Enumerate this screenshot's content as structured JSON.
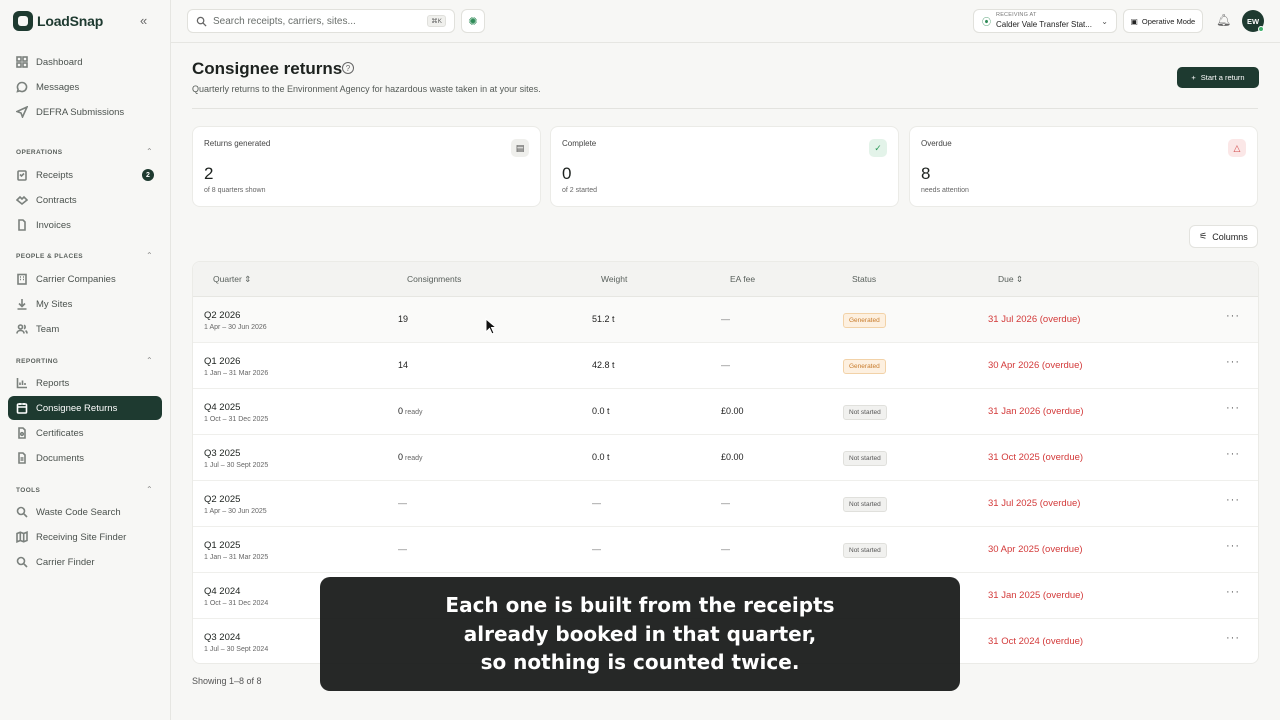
{
  "app": {
    "name": "LoadSnap"
  },
  "sidebar": {
    "top_items": [
      {
        "label": "Dashboard",
        "icon": "grid-icon"
      },
      {
        "label": "Messages",
        "icon": "message-icon"
      },
      {
        "label": "DEFRA Submissions",
        "icon": "send-icon"
      }
    ],
    "sections": [
      {
        "title": "OPERATIONS",
        "items": [
          {
            "label": "Receipts",
            "icon": "clipboard-icon",
            "badge": "2"
          },
          {
            "label": "Contracts",
            "icon": "handshake-icon"
          },
          {
            "label": "Invoices",
            "icon": "file-icon"
          }
        ]
      },
      {
        "title": "PEOPLE & PLACES",
        "items": [
          {
            "label": "Carrier Companies",
            "icon": "building-icon"
          },
          {
            "label": "My Sites",
            "icon": "download-icon"
          },
          {
            "label": "Team",
            "icon": "users-icon"
          }
        ]
      },
      {
        "title": "REPORTING",
        "items": [
          {
            "label": "Reports",
            "icon": "bar-chart-icon"
          },
          {
            "label": "Consignee Returns",
            "icon": "calendar-icon",
            "active": true
          },
          {
            "label": "Certificates",
            "icon": "certificate-icon"
          },
          {
            "label": "Documents",
            "icon": "document-icon"
          }
        ]
      },
      {
        "title": "TOOLS",
        "items": [
          {
            "label": "Waste Code Search",
            "icon": "search-icon"
          },
          {
            "label": "Receiving Site Finder",
            "icon": "map-icon"
          },
          {
            "label": "Carrier Finder",
            "icon": "search-icon"
          }
        ]
      }
    ]
  },
  "topbar": {
    "search_placeholder": "Search receipts, carriers, sites...",
    "search_shortcut": "⌘K",
    "site_label": "RECEIVING AT",
    "site_value": "Calder Vale Transfer Stat...",
    "mode_label": "Operative Mode",
    "avatar_initials": "EW"
  },
  "page": {
    "title": "Consignee returns",
    "subtitle": "Quarterly returns to the Environment Agency for hazardous waste taken in at your sites.",
    "primary_button": "Start a return",
    "columns_button": "Columns",
    "showing": "Showing 1–8 of 8"
  },
  "stats": [
    {
      "label": "Returns generated",
      "value": "2",
      "sub": "of 8 quarters shown",
      "icon": "document-icon"
    },
    {
      "label": "Complete",
      "value": "0",
      "sub": "of 2 started",
      "icon": "check-circle-icon"
    },
    {
      "label": "Overdue",
      "value": "8",
      "sub": "needs attention",
      "icon": "warning-icon"
    }
  ],
  "table": {
    "headers": [
      "Quarter",
      "Consignments",
      "Weight",
      "EA fee",
      "Status",
      "Due"
    ],
    "rows": [
      {
        "quarter": "Q2 2026",
        "range": "1 Apr – 30 Jun 2026",
        "consignments": "19",
        "ready": "",
        "weight": "51.2 t",
        "fee": "—",
        "status": "Generated",
        "due": "31 Jul 2026 (overdue)"
      },
      {
        "quarter": "Q1 2026",
        "range": "1 Jan – 31 Mar 2026",
        "consignments": "14",
        "ready": "",
        "weight": "42.8 t",
        "fee": "—",
        "status": "Generated",
        "due": "30 Apr 2026 (overdue)"
      },
      {
        "quarter": "Q4 2025",
        "range": "1 Oct – 31 Dec 2025",
        "consignments": "0",
        "ready": "ready",
        "weight": "0.0 t",
        "fee": "£0.00",
        "status": "Not started",
        "due": "31 Jan 2026 (overdue)"
      },
      {
        "quarter": "Q3 2025",
        "range": "1 Jul – 30 Sept 2025",
        "consignments": "0",
        "ready": "ready",
        "weight": "0.0 t",
        "fee": "£0.00",
        "status": "Not started",
        "due": "31 Oct 2025 (overdue)"
      },
      {
        "quarter": "Q2 2025",
        "range": "1 Apr – 30 Jun 2025",
        "consignments": "—",
        "ready": "",
        "weight": "—",
        "fee": "—",
        "status": "Not started",
        "due": "31 Jul 2025 (overdue)"
      },
      {
        "quarter": "Q1 2025",
        "range": "1 Jan – 31 Mar 2025",
        "consignments": "—",
        "ready": "",
        "weight": "—",
        "fee": "—",
        "status": "Not started",
        "due": "30 Apr 2025 (overdue)"
      },
      {
        "quarter": "Q4 2024",
        "range": "1 Oct – 31 Dec 2024",
        "consignments": "",
        "ready": "",
        "weight": "",
        "fee": "",
        "status": "",
        "due": "31 Jan 2025 (overdue)"
      },
      {
        "quarter": "Q3 2024",
        "range": "1 Jul – 30 Sept 2024",
        "consignments": "",
        "ready": "",
        "weight": "",
        "fee": "",
        "status": "",
        "due": "31 Oct 2024 (overdue)"
      }
    ]
  },
  "caption": {
    "lines": [
      "Each one is built from the receipts",
      "already booked in that quarter,",
      "so nothing is counted twice."
    ]
  },
  "colors": {
    "brand": "#1e3a30",
    "overdue": "#d33a3a",
    "generated": "#c77b2b"
  }
}
